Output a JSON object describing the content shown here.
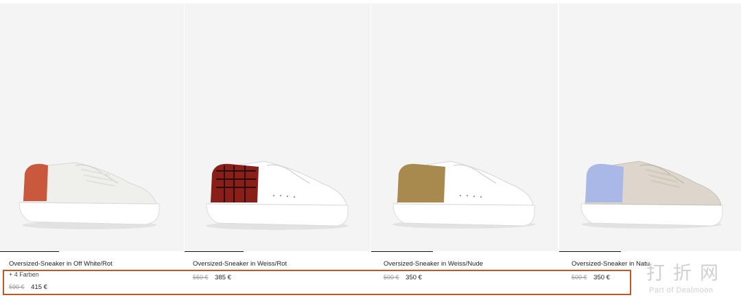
{
  "products": [
    {
      "name": "Oversized-Sneaker in Off White/Rot",
      "colors_note": "+ 4 Farben",
      "old_price": "590 €",
      "price": "415 €",
      "heel_color": "#c9593c",
      "body_color": "#efefec"
    },
    {
      "name": "Oversized-Sneaker in Weiss/Rot",
      "colors_note": "",
      "old_price": "550 €",
      "price": "385 €",
      "heel_color": "#8a1f1a",
      "body_color": "#ffffff"
    },
    {
      "name": "Oversized-Sneaker in Weiss/Nude",
      "colors_note": "",
      "old_price": "500 €",
      "price": "350 €",
      "heel_color": "#a88a4e",
      "body_color": "#ffffff"
    },
    {
      "name": "Oversized-Sneaker in Natu",
      "colors_note": "",
      "old_price": "500 €",
      "price": "350 €",
      "heel_color": "#a9b8e6",
      "body_color": "#dcd6cc"
    }
  ],
  "watermark": {
    "cjk": "打折网",
    "en": "Part of Dealmoon"
  }
}
